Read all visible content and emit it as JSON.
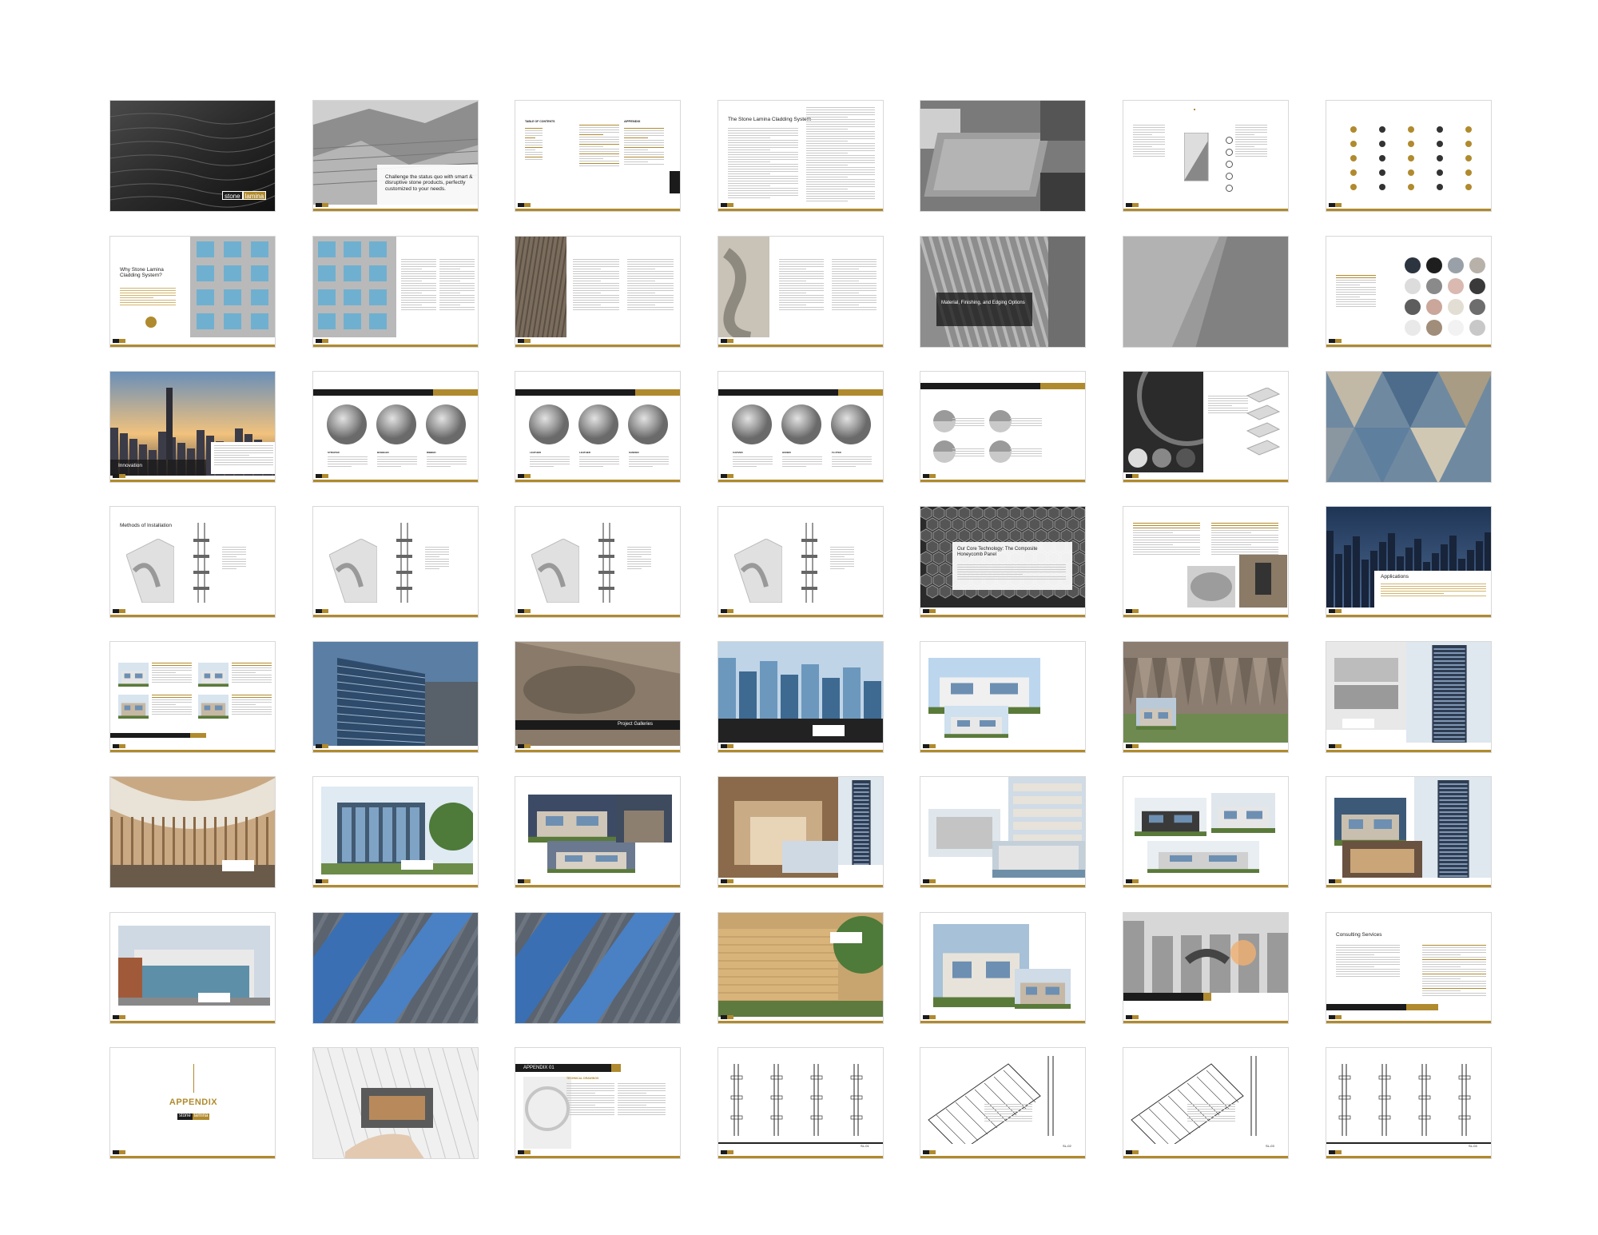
{
  "colors": {
    "gold": "#b08a2e",
    "dark": "#1b1b1b",
    "page_border": "#d8d8d8",
    "background": "#ffffff"
  },
  "brand": {
    "word1": "stone",
    "word2": "lamina"
  },
  "site": "STONELAMINA.COM",
  "pages": [
    {
      "id": "cover",
      "layout": "cover-slate",
      "brand1": "stone",
      "brand2": "lamina"
    },
    {
      "id": "intro",
      "layout": "quarry",
      "text": "Challenge the status quo with smart & disruptive stone products, perfectly customized to your needs."
    },
    {
      "id": "toc",
      "layout": "toc",
      "heading": "TABLE OF CONTENTS",
      "heading2": "APPENDIX"
    },
    {
      "id": "system",
      "layout": "text-2col",
      "heading": "The Stone Lamina Cladding System"
    },
    {
      "id": "panels",
      "layout": "photo-panels"
    },
    {
      "id": "diagram",
      "layout": "diagram-panel"
    },
    {
      "id": "icons",
      "layout": "icon-grid"
    },
    {
      "id": "why",
      "layout": "why",
      "heading": "Why Stone Lamina Cladding System?"
    },
    {
      "id": "building-text",
      "layout": "building-text"
    },
    {
      "id": "stone-text",
      "layout": "stone-text"
    },
    {
      "id": "flex-text",
      "layout": "flex-text"
    },
    {
      "id": "material",
      "layout": "material",
      "text": "Material, Finishing, and Edging Options"
    },
    {
      "id": "texture",
      "layout": "texture"
    },
    {
      "id": "swatches",
      "layout": "swatches"
    },
    {
      "id": "innovation",
      "layout": "city",
      "text": "Innovation"
    },
    {
      "id": "finish1",
      "layout": "finish-circles",
      "labels": [
        "STRIATED",
        "BUBBLED",
        "RIBBED"
      ]
    },
    {
      "id": "finish2",
      "layout": "finish-circles",
      "labels": [
        "LEATHER",
        "LEATHER",
        "SANDED"
      ]
    },
    {
      "id": "finish3",
      "layout": "finish-circles",
      "labels": [
        "CARVED",
        "HONED",
        "FLUTED"
      ]
    },
    {
      "id": "edging",
      "layout": "edging"
    },
    {
      "id": "rings",
      "layout": "rings"
    },
    {
      "id": "triangles",
      "layout": "triangles"
    },
    {
      "id": "install1",
      "layout": "install",
      "heading": "Methods of Installation"
    },
    {
      "id": "install2",
      "layout": "install",
      "heading": ""
    },
    {
      "id": "install3",
      "layout": "install",
      "heading": ""
    },
    {
      "id": "install4",
      "layout": "install",
      "heading": ""
    },
    {
      "id": "core",
      "layout": "honeycomb",
      "text": "Our Core Technology: The Composite Honeycomb Panel"
    },
    {
      "id": "core-text",
      "layout": "core-text"
    },
    {
      "id": "applications",
      "layout": "skyline",
      "text": "Applications"
    },
    {
      "id": "apps-list",
      "layout": "apps-list"
    },
    {
      "id": "glass-building",
      "layout": "glass-building"
    },
    {
      "id": "galleries",
      "layout": "galleries",
      "text": "Project Galleries"
    },
    {
      "id": "gallery1",
      "layout": "gallery-glass"
    },
    {
      "id": "gallery2",
      "layout": "gallery-white"
    },
    {
      "id": "gallery3",
      "layout": "gallery-stone"
    },
    {
      "id": "gallery4",
      "layout": "gallery-tower"
    },
    {
      "id": "gallery5",
      "layout": "gallery-lobby"
    },
    {
      "id": "gallery6",
      "layout": "gallery-glassbox"
    },
    {
      "id": "gallery7",
      "layout": "gallery-houses"
    },
    {
      "id": "gallery8",
      "layout": "gallery-interior"
    },
    {
      "id": "gallery9",
      "layout": "gallery-condo"
    },
    {
      "id": "gallery10",
      "layout": "gallery-modern"
    },
    {
      "id": "gallery11",
      "layout": "gallery-tower2"
    },
    {
      "id": "gallery12",
      "layout": "gallery-store"
    },
    {
      "id": "facade1",
      "layout": "facade"
    },
    {
      "id": "facade2",
      "layout": "facade"
    },
    {
      "id": "gallery13",
      "layout": "gallery-warm"
    },
    {
      "id": "gallery14",
      "layout": "gallery-townhouse"
    },
    {
      "id": "handshake",
      "layout": "handshake"
    },
    {
      "id": "consulting",
      "layout": "consulting",
      "heading": "Consulting Services"
    },
    {
      "id": "appendix",
      "layout": "appendix",
      "text": "APPENDIX",
      "brand1": "stone",
      "brand2": "lamina"
    },
    {
      "id": "sketch",
      "layout": "sketch"
    },
    {
      "id": "appendix01",
      "layout": "appendix01",
      "text": "APPENDIX 01",
      "heading": "TECHNICAL DRAWINGS"
    },
    {
      "id": "dwg1",
      "layout": "drawing",
      "code": "SL-01"
    },
    {
      "id": "dwg2",
      "layout": "drawing-iso",
      "code": "SL-02"
    },
    {
      "id": "dwg3",
      "layout": "drawing-iso",
      "code": "SL-03"
    },
    {
      "id": "dwg4",
      "layout": "drawing",
      "code": "SL-04"
    }
  ]
}
